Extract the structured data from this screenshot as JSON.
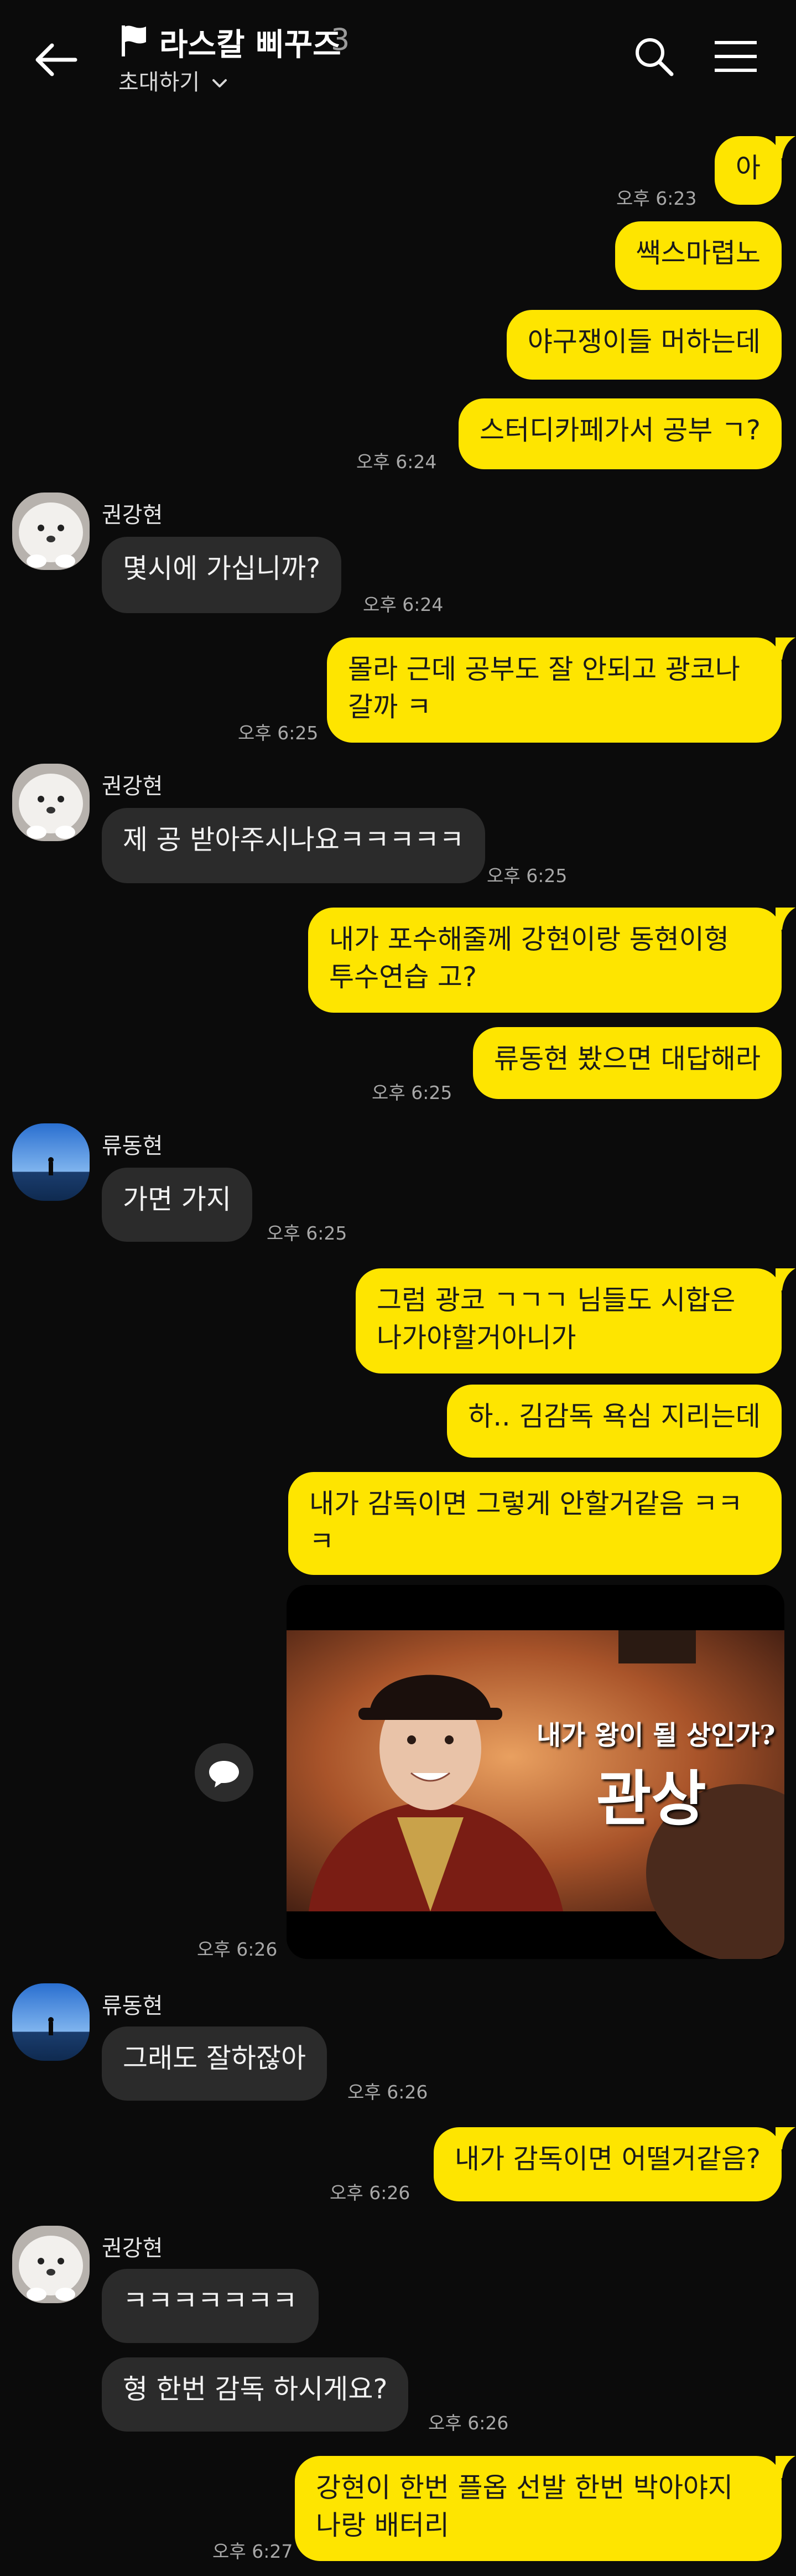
{
  "header": {
    "room_title": "라스칼 삐꾸즈",
    "member_count": "3",
    "invite_label": "초대하기"
  },
  "colors": {
    "my_bubble": "#fee500",
    "their_bubble": "#2b2b2b",
    "background": "#0b0b0b"
  },
  "icons": [
    "back-arrow-icon",
    "flag-icon",
    "chevron-down-icon",
    "search-icon",
    "hamburger-menu-icon",
    "share-icon"
  ],
  "messages": {
    "m1": {
      "text": "아",
      "time": "오후 6:23"
    },
    "m2": {
      "text": "쌕스마렵노"
    },
    "m3": {
      "text": "야구쟁이들 머하는데"
    },
    "m4": {
      "text": "스터디카페가서 공부 ㄱ?",
      "time": "오후 6:24"
    },
    "m5": {
      "sender": "권강현",
      "text": "몇시에 가십니까?",
      "time": "오후 6:24"
    },
    "m6": {
      "text": "몰라 근데 공부도 잘 안되고 광코나\n갈까 ㅋ",
      "time": "오후 6:25"
    },
    "m7": {
      "sender": "권강현",
      "text": "제 공 받아주시나요ㅋㅋㅋㅋㅋ",
      "time": "오후 6:25"
    },
    "m8": {
      "text": "내가 포수해줄께 강현이랑 동현이형\n투수연습 고?"
    },
    "m9": {
      "text": "류동현 봤으면 대답해라",
      "time": "오후 6:25"
    },
    "m10": {
      "sender": "류동현",
      "text": "가면 가지",
      "time": "오후 6:25"
    },
    "m11": {
      "text": "그럼 광코 ㄱㄱㄱ 님들도 시합은\n나가야할거아니가"
    },
    "m12": {
      "text": "하.. 김감독 욕심 지리는데"
    },
    "m13": {
      "text": "내가 감독이면 그렇게 안할거같음 ㅋㅋ\nㅋ"
    },
    "m14": {
      "image_text_line1": "내가 왕이 될 상인가?",
      "image_text_line2": "관상",
      "time": "오후 6:26"
    },
    "m15": {
      "sender": "류동현",
      "text": "그래도 잘하잖아",
      "time": "오후 6:26"
    },
    "m16": {
      "text": "내가 감독이면 어떨거같음?",
      "time": "오후 6:26"
    },
    "m17": {
      "sender": "권강현",
      "text": "ㅋㅋㅋㅋㅋㅋㅋ"
    },
    "m18": {
      "text": "형 한번 감독 하시게요?",
      "time": "오후 6:26"
    },
    "m19": {
      "text": "강현이 한번 플옵 선발 한번 박아야지\n나랑 배터리",
      "time": "오후 6:27"
    }
  }
}
